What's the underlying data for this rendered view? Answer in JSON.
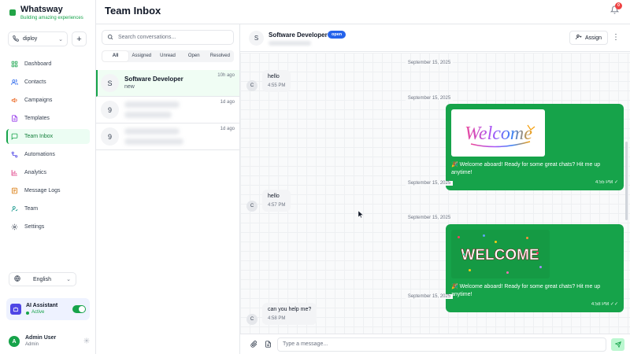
{
  "brand": {
    "name": "Whatsway",
    "tagline": "Building amazing experiences",
    "color": "#22a447"
  },
  "channel": {
    "selected": "diploy",
    "add_label": "+"
  },
  "sidebar": {
    "items": [
      {
        "label": "Dashboard",
        "icon": "grid-icon",
        "active": false
      },
      {
        "label": "Contacts",
        "icon": "users-icon",
        "active": false
      },
      {
        "label": "Campaigns",
        "icon": "megaphone-icon",
        "active": false
      },
      {
        "label": "Templates",
        "icon": "file-icon",
        "active": false
      },
      {
        "label": "Team Inbox",
        "icon": "message-icon",
        "active": true
      },
      {
        "label": "Automations",
        "icon": "workflow-icon",
        "active": false
      },
      {
        "label": "Analytics",
        "icon": "bar-chart-icon",
        "active": false
      },
      {
        "label": "Message Logs",
        "icon": "logs-icon",
        "active": false
      },
      {
        "label": "Team",
        "icon": "team-icon",
        "active": false
      },
      {
        "label": "Settings",
        "icon": "gear-icon",
        "active": false
      }
    ],
    "language": "English",
    "ai": {
      "title": "AI Assistant",
      "status": "Active",
      "enabled": true
    },
    "user": {
      "name": "Admin User",
      "role": "Admin",
      "initial": "A"
    }
  },
  "page": {
    "title": "Team Inbox",
    "notifications": "0"
  },
  "inbox": {
    "search_placeholder": "Search conversations...",
    "filters": [
      "All",
      "Assigned",
      "Unread",
      "Open",
      "Resolved"
    ],
    "conversations": [
      {
        "initial": "S",
        "name": "Software Developer",
        "preview": "new",
        "time": "10h ago"
      },
      {
        "initial": "9",
        "name": "",
        "preview": "",
        "time": "1d ago"
      },
      {
        "initial": "9",
        "name": "",
        "preview": "",
        "time": "1d ago"
      }
    ]
  },
  "chat": {
    "contact_initial": "S",
    "contact_name": "Software Developer",
    "status_badge": "open",
    "assign_label": "Assign",
    "messages": [
      {
        "date": "September 15, 2025"
      },
      {
        "text": "hello",
        "time": "4:55 PM",
        "sender": "C"
      },
      {
        "date": "September 15, 2025"
      },
      {
        "image": "Welcome",
        "caption": "🎉 Welcome aboard! Ready for some great chats? Hit me up anytime!",
        "time": "4:55 PM"
      },
      {
        "date": "September 15, 2025"
      },
      {
        "text": "hello",
        "time": "4:57 PM",
        "sender": "C"
      },
      {
        "date": "September 15, 2025"
      },
      {
        "image": "WELCOME",
        "caption": "🎉 Welcome aboard! Ready for some great chats? Hit me up anytime!",
        "time": "4:58 PM"
      },
      {
        "date": "September 15, 2025"
      },
      {
        "text": "can you help me?",
        "time": "4:58 PM",
        "sender": "C"
      }
    ],
    "composer_placeholder": "Type a message..."
  },
  "colors": {
    "accent": "#16a34a",
    "badge": "#2563eb",
    "notification": "#ef4444"
  }
}
